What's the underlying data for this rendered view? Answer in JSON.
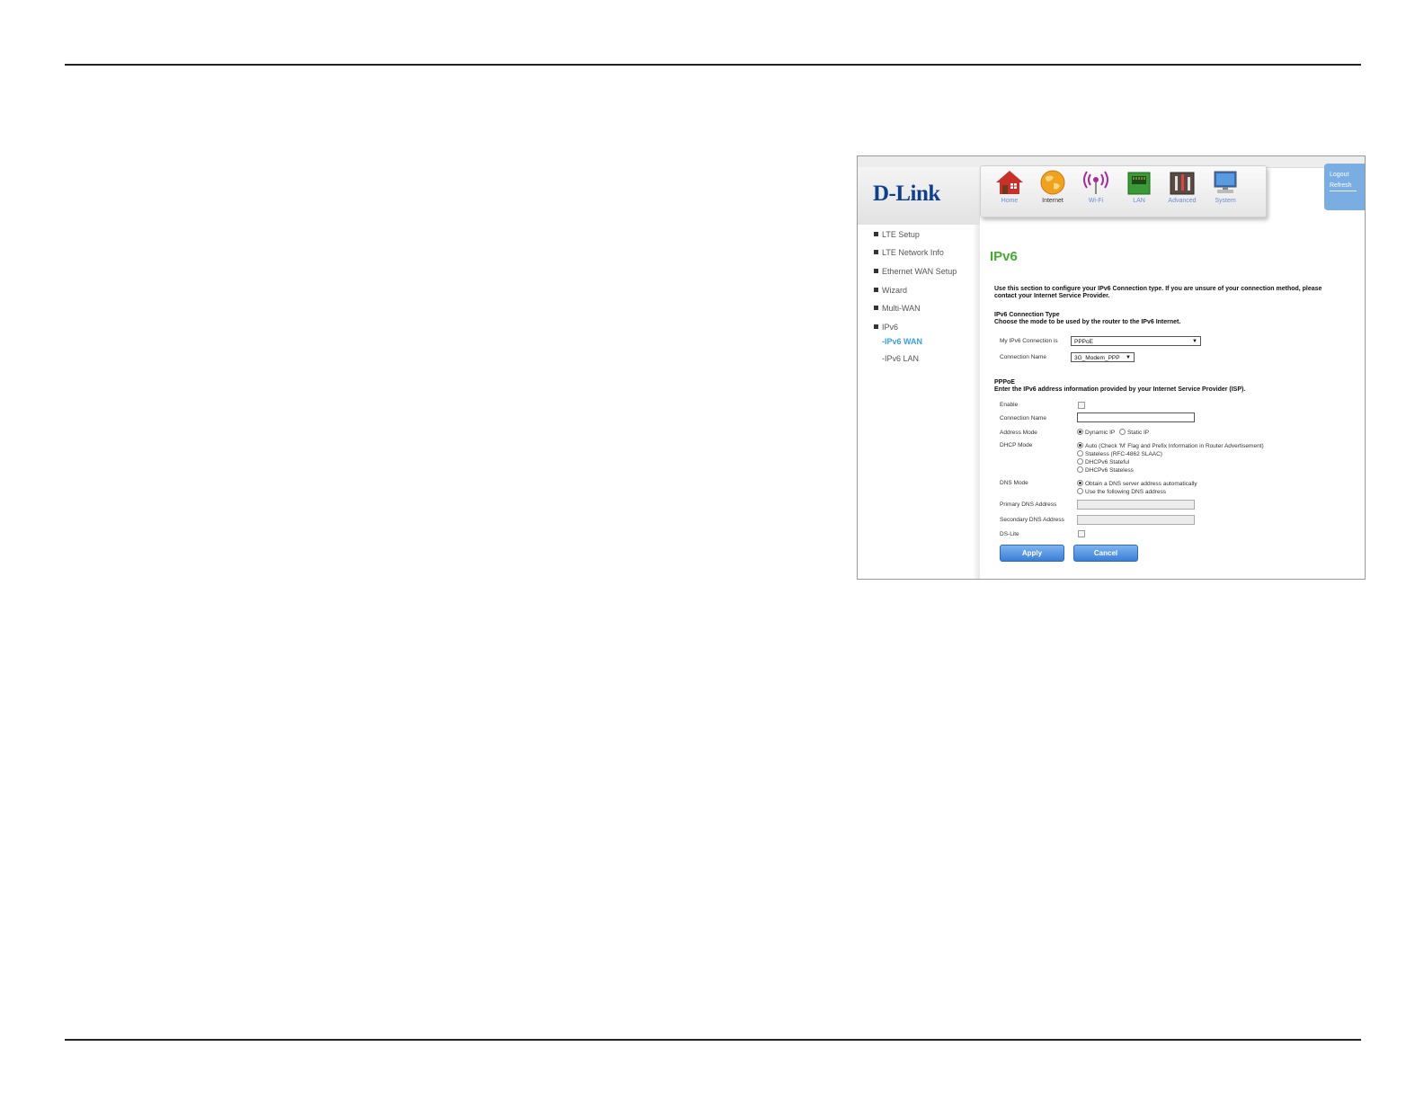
{
  "brand": "D-Link",
  "colors": {
    "title_green": "#44aa33",
    "nav_label_blue": "#6a8ed8",
    "active_sub_blue": "#3aa0e0",
    "button_blue": "#3a7fd6",
    "account_box": "#7aaee2"
  },
  "nav": [
    {
      "label": "Home",
      "icon": "home-icon"
    },
    {
      "label": "Internet",
      "icon": "globe-icon",
      "active": true
    },
    {
      "label": "Wi-Fi",
      "icon": "wifi-antenna-icon"
    },
    {
      "label": "LAN",
      "icon": "lan-port-icon"
    },
    {
      "label": "Advanced",
      "icon": "tools-icon"
    },
    {
      "label": "System",
      "icon": "computer-icon"
    }
  ],
  "account": {
    "logout": "Logout",
    "refresh": "Refresh"
  },
  "sidebar": {
    "items": [
      "LTE Setup",
      "LTE Network Info",
      "Ethernet WAN Setup",
      "Wizard",
      "Multi-WAN",
      "IPv6"
    ],
    "sub": [
      "-IPv6 WAN",
      "-IPv6 LAN"
    ],
    "active_sub": "-IPv6 WAN"
  },
  "content": {
    "title": "IPv6",
    "intro_line1": "Use this section to configure your IPv6 Connection type. If you are unsure of your connection method, please",
    "intro_line2": "contact your Internet Service Provider.",
    "conn_type_heading": "IPv6 Connection Type",
    "conn_type_desc": "Choose the mode to be used by the router to the IPv6 Internet.",
    "my_conn_label": "My IPv6 Connection is",
    "my_conn_value": "PPPoE",
    "conn_name_label": "Connection Name",
    "conn_name_value": "3G_Modem_PPP",
    "pppoe_heading": "PPPoE",
    "pppoe_desc": "Enter the IPv6 address information provided by your Internet Service Provider (ISP).",
    "enable_label": "Enable",
    "pppoe_conn_name_label": "Connection Name",
    "pppoe_conn_name_value": "",
    "address_mode_label": "Address Mode",
    "address_mode_options": [
      "Dynamic IP",
      "Static IP"
    ],
    "dhcp_mode_label": "DHCP Mode",
    "dhcp_mode_options": [
      "Auto (Check 'M' Flag and Prefix Information in Router Advertisement)",
      "Stateless (RFC-4862 SLAAC)",
      "DHCPv6 Stateful",
      "DHCPv6 Stateless"
    ],
    "dns_mode_label": "DNS Mode",
    "dns_mode_options": [
      "Obtain a DNS server address automatically",
      "Use the following DNS address"
    ],
    "primary_dns_label": "Primary DNS Address",
    "secondary_dns_label": "Secondary DNS Address",
    "ds_lite_label": "DS-Lite",
    "apply_label": "Apply",
    "cancel_label": "Cancel"
  }
}
